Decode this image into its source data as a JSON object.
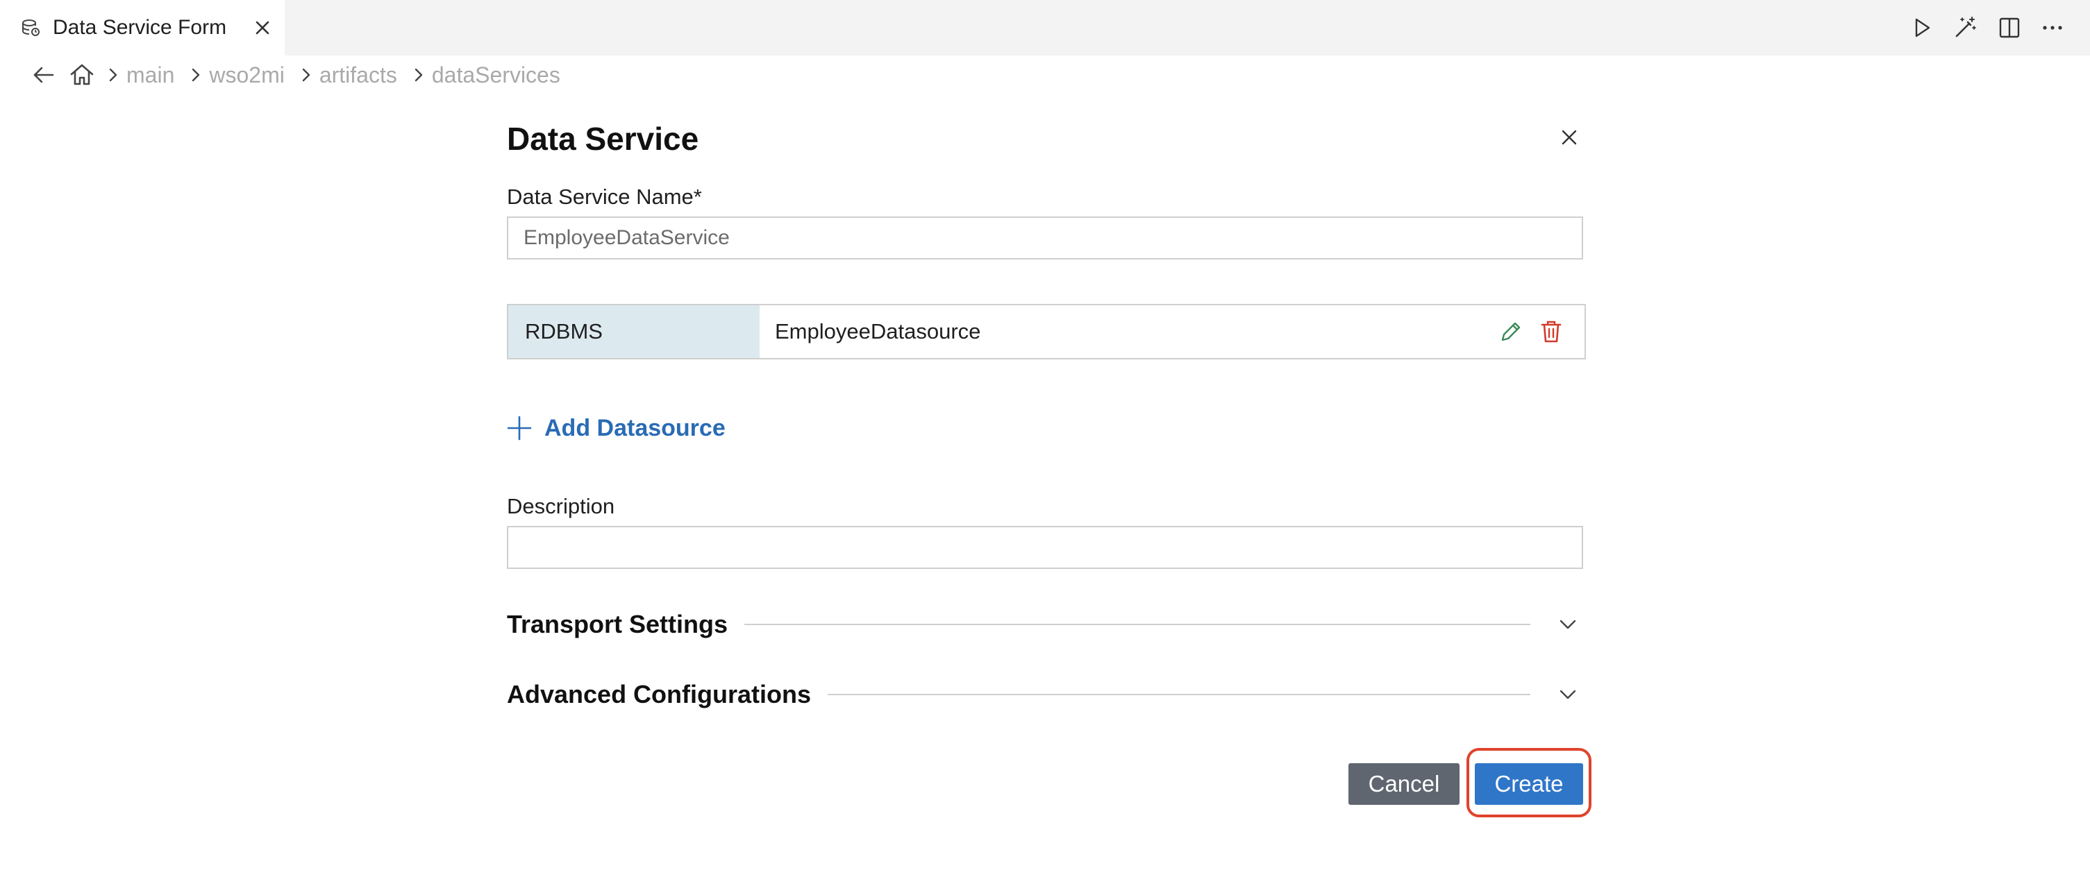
{
  "tab": {
    "title": "Data Service Form",
    "icon": "data-service-icon"
  },
  "toolbar": {
    "actions": [
      "run-icon",
      "magic-wand-icon",
      "split-editor-icon",
      "more-icon"
    ]
  },
  "breadcrumb": {
    "items": [
      "main",
      "wso2mi",
      "artifacts",
      "dataServices"
    ]
  },
  "form": {
    "title": "Data Service",
    "name_label": "Data Service Name*",
    "name_value": "EmployeeDataService",
    "datasource": {
      "type": "RDBMS",
      "name": "EmployeeDatasource"
    },
    "add_datasource_label": "Add Datasource",
    "description_label": "Description",
    "description_value": "",
    "transport_settings_label": "Transport Settings",
    "advanced_config_label": "Advanced Configurations",
    "cancel_label": "Cancel",
    "create_label": "Create"
  },
  "colors": {
    "accent": "#2f76c8",
    "link": "#2a6bb5",
    "cancel_bg": "#5f6670",
    "highlight": "#e0432d",
    "datasource_type_bg": "#dceaf0",
    "edit_icon": "#3b8a5a",
    "delete_icon": "#d23b2a"
  }
}
